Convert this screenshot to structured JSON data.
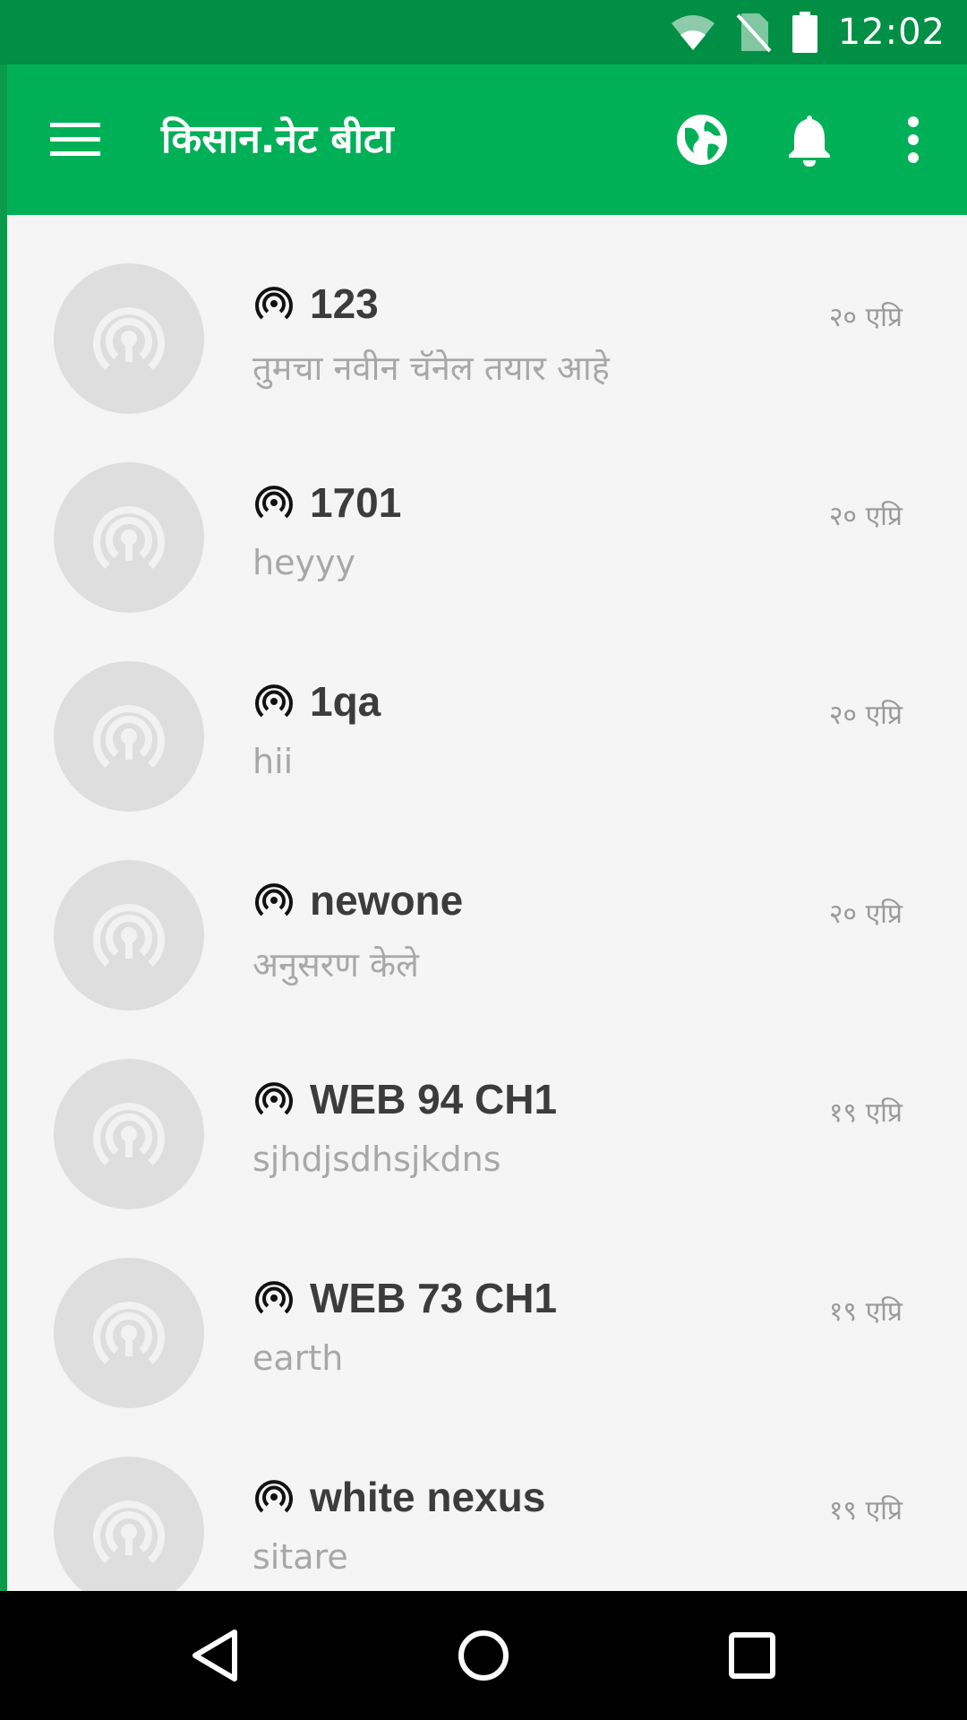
{
  "status_bar": {
    "time": "12:02",
    "icons": [
      "wifi-icon",
      "no-sim-icon",
      "battery-icon"
    ]
  },
  "app_bar": {
    "title": "किसान.नेट बीटा",
    "menu_icon": "hamburger-menu-icon",
    "actions": [
      "globe-icon",
      "notification-bell-icon",
      "more-vert-icon"
    ],
    "background": "#00b057"
  },
  "channels": [
    {
      "name": "123",
      "message": "तुमचा नवीन चॅनेल तयार आहे",
      "date": "२० एप्रि"
    },
    {
      "name": "1701",
      "message": "heyyy",
      "date": "२० एप्रि"
    },
    {
      "name": "1qa",
      "message": "hii",
      "date": "२० एप्रि"
    },
    {
      "name": "newone",
      "message": "अनुसरण केले",
      "date": "२० एप्रि"
    },
    {
      "name": "WEB 94 CH1",
      "message": "sjhdjsdhsjkdns",
      "date": "१९ एप्रि"
    },
    {
      "name": "WEB 73 CH1",
      "message": "earth",
      "date": "१९ एप्रि"
    },
    {
      "name": "white nexus",
      "message": "sitare",
      "date": "१९ एप्रि"
    }
  ],
  "nav_bar": {
    "buttons": [
      "back-icon",
      "home-icon",
      "recents-icon"
    ]
  },
  "colors": {
    "status_bar": "#008f44",
    "accent": "#00b057",
    "list_background": "#f5f5f5",
    "avatar": "#dedede"
  }
}
